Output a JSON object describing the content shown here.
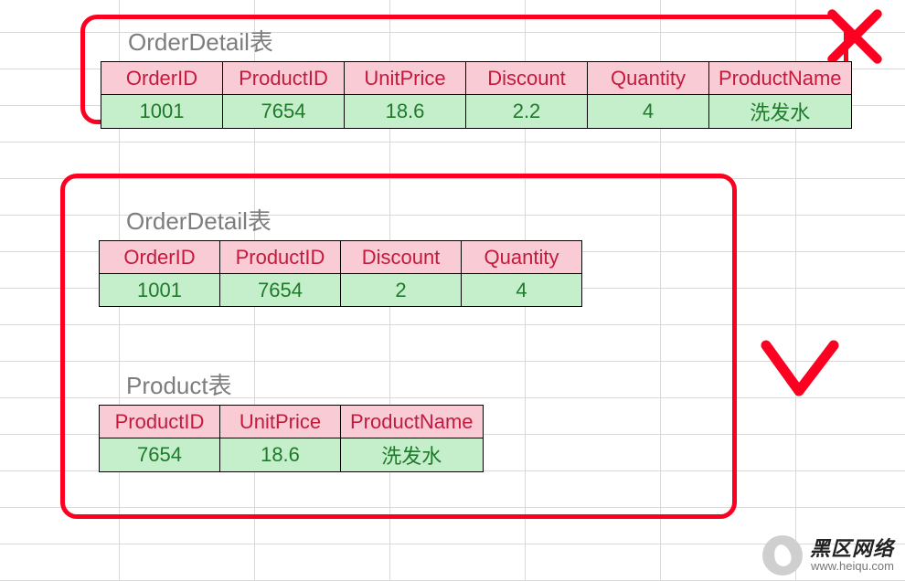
{
  "colors": {
    "annotation": "#fd0021",
    "header_bg": "#f9cbd4",
    "header_fg": "#c31a3d",
    "cell_bg": "#c5efcb",
    "cell_fg": "#1e7a2a"
  },
  "table1": {
    "title": "OrderDetail表",
    "headers": [
      "OrderID",
      "ProductID",
      "UnitPrice",
      "Discount",
      "Quantity",
      "ProductName"
    ],
    "row": [
      "1001",
      "7654",
      "18.6",
      "2.2",
      "4",
      "洗发水"
    ]
  },
  "table2": {
    "title": "OrderDetail表",
    "headers": [
      "OrderID",
      "ProductID",
      "Discount",
      "Quantity"
    ],
    "row": [
      "1001",
      "7654",
      "2",
      "4"
    ]
  },
  "table3": {
    "title": "Product表",
    "headers": [
      "ProductID",
      "UnitPrice",
      "ProductName"
    ],
    "row": [
      "7654",
      "18.6",
      "洗发水"
    ]
  },
  "annotations": {
    "box1_mark": "x-mark",
    "box2_mark": "check-mark"
  },
  "watermark": {
    "main": "黑区网络",
    "sub": "www.heiqu.com"
  }
}
